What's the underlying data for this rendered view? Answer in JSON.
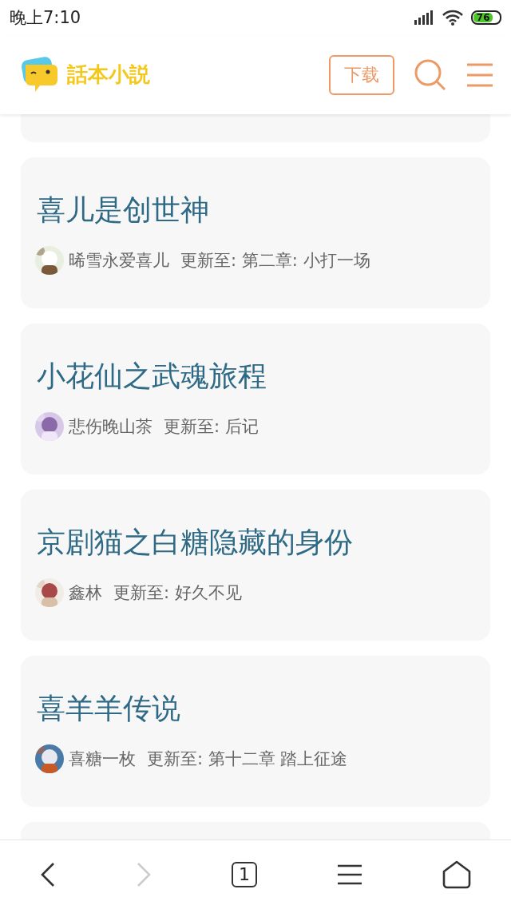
{
  "status_bar": {
    "time": "晚上7:10",
    "battery": "76"
  },
  "header": {
    "logo_text": "話本小説",
    "download_button": "下载"
  },
  "stories": [
    {
      "title": "喜儿是创世神",
      "author": "晞雪永爱喜儿",
      "update": "更新至: 第二章: 小打一场"
    },
    {
      "title": "小花仙之武魂旅程",
      "author": "悲伤晚山茶",
      "update": "更新至: 后记"
    },
    {
      "title": "京剧猫之白糖隐藏的身份",
      "author": "鑫林",
      "update": "更新至: 好久不见"
    },
    {
      "title": "喜羊羊传说",
      "author": "喜糖一枚",
      "update": "更新至: 第十二章 踏上征途"
    }
  ],
  "bottom_nav": {
    "back_disabled": false,
    "forward_disabled": true,
    "tab_count": "1"
  }
}
